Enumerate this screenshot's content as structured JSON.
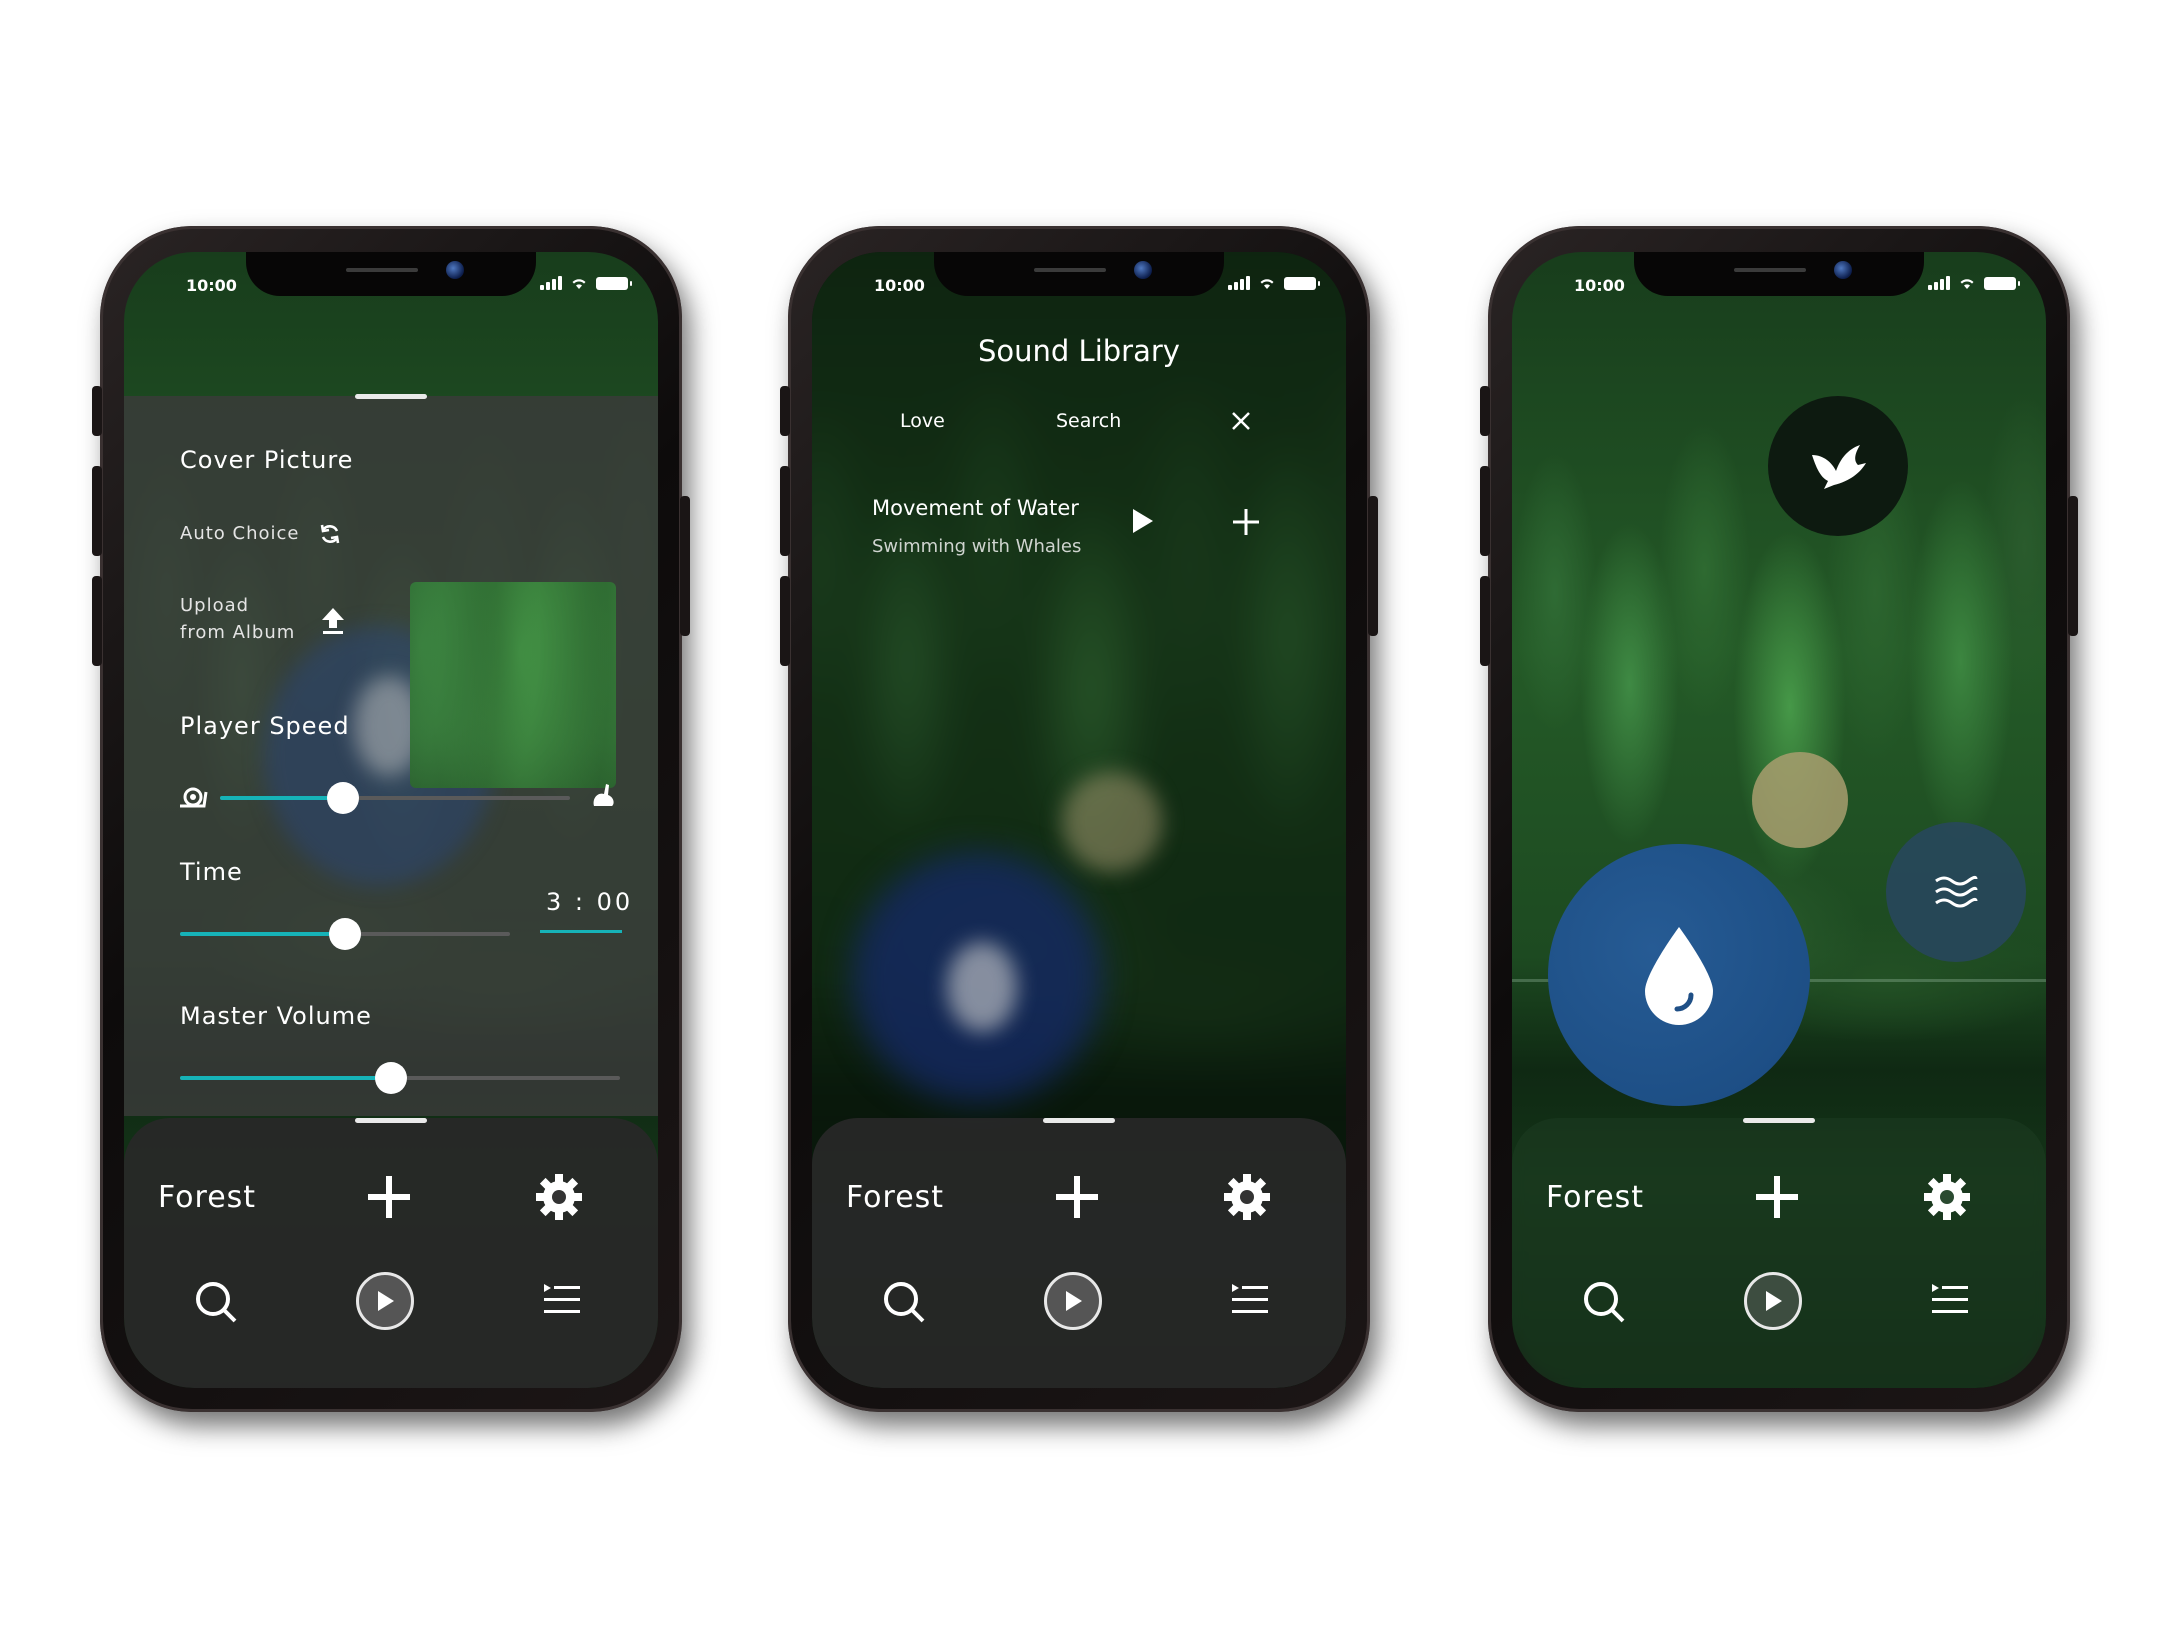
{
  "status": {
    "time": "10:00"
  },
  "phone1": {
    "cover": {
      "title": "Cover Picture",
      "auto_choice": "Auto Choice",
      "upload_line1": "Upload",
      "upload_line2": "from Album"
    },
    "player_speed": {
      "label": "Player Speed",
      "value": 0.35
    },
    "time": {
      "label": "Time",
      "value": "3 : 00",
      "slider": 0.5
    },
    "master_volume": {
      "label": "Master Volume",
      "value": 0.48
    },
    "bottom": {
      "title": "Forest"
    }
  },
  "phone2": {
    "title": "Sound Library",
    "tabs": [
      "Love",
      "Search"
    ],
    "track": {
      "title": "Movement of Water",
      "subtitle": "Swimming with Whales"
    },
    "bottom": {
      "title": "Forest"
    }
  },
  "phone3": {
    "bubbles": [
      "bird-icon",
      "leaf-sound",
      "waves-icon",
      "water-drop-icon"
    ],
    "bottom": {
      "title": "Forest"
    }
  },
  "icons": {
    "plus": "plus-icon",
    "gear": "gear-icon",
    "search": "search-icon",
    "play": "play-icon",
    "list": "playlist-icon",
    "close": "close-icon"
  },
  "colors": {
    "accent": "#16b3b8",
    "water_bubble": "#1d4f86",
    "panel": "#3a3a3a"
  }
}
